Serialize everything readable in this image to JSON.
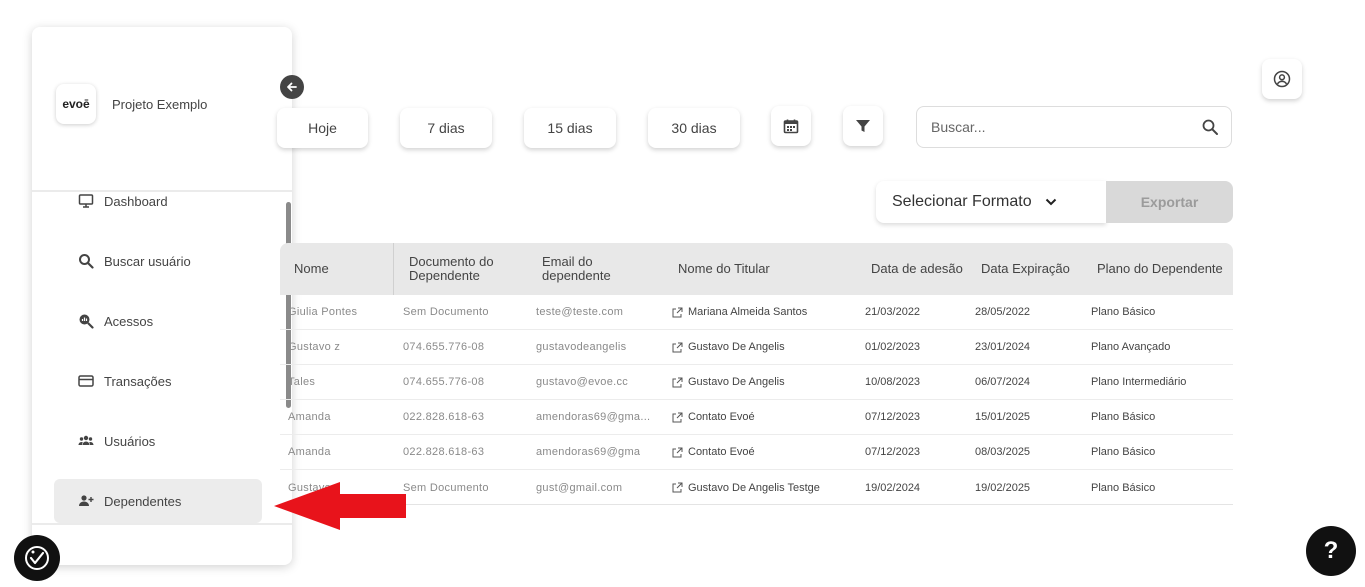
{
  "sidebar": {
    "brand": {
      "logo_text": "evoē",
      "name": "Projeto Exemplo"
    },
    "items": [
      {
        "label": "Dashboard",
        "icon": "monitor-icon"
      },
      {
        "label": "Buscar usuário",
        "icon": "search-icon"
      },
      {
        "label": "Acessos",
        "icon": "access-search-icon"
      },
      {
        "label": "Transações",
        "icon": "credit-card-icon"
      },
      {
        "label": "Usuários",
        "icon": "users-icon"
      },
      {
        "label": "Dependentes",
        "icon": "user-add-icon",
        "active": true
      }
    ]
  },
  "filters": {
    "today": "Hoje",
    "d7": "7 dias",
    "d15": "15 dias",
    "d30": "30 dias",
    "calendar_icon": "calendar-icon",
    "filter_icon": "filter-icon"
  },
  "search": {
    "placeholder": "Buscar..."
  },
  "export": {
    "format_label": "Selecionar Formato",
    "export_label": "Exportar"
  },
  "table": {
    "headers": [
      "Nome",
      "Documento do Dependente",
      "Email do dependente",
      "Nome do Titular",
      "Data de adesão",
      "Data Expiração",
      "Plano do Dependente"
    ],
    "rows": [
      [
        "Giulia Pontes",
        "Sem Documento",
        "teste@teste.com",
        "Mariana Almeida Santos",
        "21/03/2022",
        "28/05/2022",
        "Plano Básico"
      ],
      [
        "Gustavo z",
        "074.655.776-08",
        "gustavodeangelis",
        "Gustavo De Angelis",
        "01/02/2023",
        "23/01/2024",
        "Plano Avançado"
      ],
      [
        "Tales",
        "074.655.776-08",
        "gustavo@evoe.cc",
        "Gustavo De Angelis",
        "10/08/2023",
        "06/07/2024",
        "Plano Intermediário"
      ],
      [
        "Amanda",
        "022.828.618-63",
        "amendoras69@gma...",
        "Contato Evoé",
        "07/12/2023",
        "15/01/2025",
        "Plano Básico"
      ],
      [
        "Amanda",
        "022.828.618-63",
        "amendoras69@gma",
        "Contato Evoé",
        "07/12/2023",
        "08/03/2025",
        "Plano Básico"
      ],
      [
        "Gustavo",
        "Sem Documento",
        "gust@gmail.com",
        "Gustavo De Angelis Testge",
        "19/02/2024",
        "19/02/2025",
        "Plano Básico"
      ]
    ]
  },
  "colors": {
    "arrow": "#e8131b",
    "accent_dark": "#111111"
  }
}
